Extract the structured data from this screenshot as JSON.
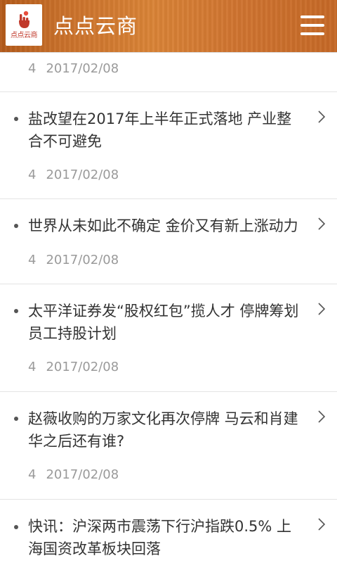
{
  "header": {
    "logo_text": "点点云商",
    "title": "点点云商",
    "menu_icon": "hamburger-menu-icon",
    "logo_color": "#c0392b"
  },
  "items": [
    {
      "title": "",
      "count": "4",
      "date": "2017/02/08"
    },
    {
      "title": "盐改望在2017年上半年正式落地 产业整合不可避免",
      "count": "4",
      "date": "2017/02/08"
    },
    {
      "title": "世界从未如此不确定 金价又有新上涨动力",
      "count": "4",
      "date": "2017/02/08"
    },
    {
      "title": "太平洋证券发“股权红包”揽人才 停牌筹划员工持股计划",
      "count": "4",
      "date": "2017/02/08"
    },
    {
      "title": "赵薇收购的万家文化再次停牌 马云和肖建华之后还有谁?",
      "count": "4",
      "date": "2017/02/08"
    },
    {
      "title": "快讯：沪深两市震荡下行沪指跌0.5% 上海国资改革板块回落",
      "count": "",
      "date": ""
    }
  ],
  "colors": {
    "header": "#cf7430",
    "title_text": "#333333",
    "meta_text": "#9a9a9a",
    "divider": "#e4e4e4"
  }
}
